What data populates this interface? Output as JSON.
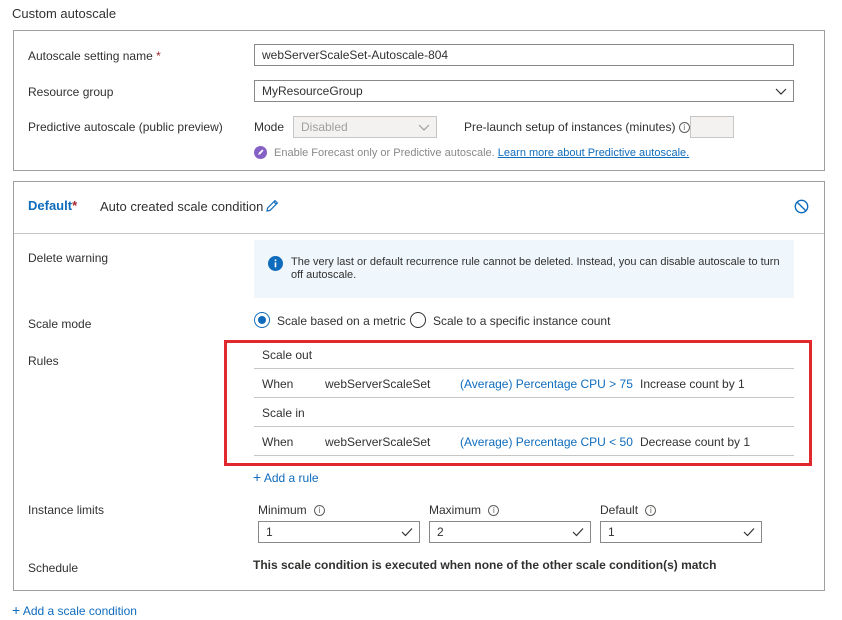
{
  "section": {
    "title": "Custom autoscale"
  },
  "settings": {
    "name_label": "Autoscale setting name",
    "required_mark": "*",
    "name_value": "webServerScaleSet-Autoscale-804",
    "rg_label": "Resource group",
    "rg_value": "MyResourceGroup",
    "predictive_label": "Predictive autoscale (public preview)",
    "mode_label": "Mode",
    "mode_value": "Disabled",
    "prelaunch_label": "Pre-launch setup of instances (minutes)",
    "prelaunch_value": "",
    "forecast_text": "Enable Forecast only or Predictive autoscale.",
    "forecast_link": "Learn more about Predictive autoscale."
  },
  "condition": {
    "title": "Default",
    "required_mark": "*",
    "name": "Auto created scale condition",
    "delete_warning_label": "Delete warning",
    "delete_warning_text": "The very last or default recurrence rule cannot be deleted. Instead, you can disable autoscale to turn off autoscale.",
    "scale_mode_label": "Scale mode",
    "scale_mode_options": [
      "Scale based on a metric",
      "Scale to a specific instance count"
    ],
    "rules_label": "Rules",
    "scale_out_title": "Scale out",
    "scale_in_title": "Scale in",
    "scale_out_rule": {
      "when": "When",
      "resource": "webServerScaleSet",
      "metric": "(Average) Percentage CPU > 75",
      "action": "Increase count by 1"
    },
    "scale_in_rule": {
      "when": "When",
      "resource": "webServerScaleSet",
      "metric": "(Average) Percentage CPU < 50",
      "action": "Decrease count by 1"
    },
    "add_rule": "Add a rule",
    "instance_limits_label": "Instance limits",
    "min_label": "Minimum",
    "min_value": "1",
    "max_label": "Maximum",
    "max_value": "2",
    "default_label": "Default",
    "default_value": "1",
    "schedule_label": "Schedule",
    "schedule_text": "This scale condition is executed when none of the other scale condition(s) match"
  },
  "footer": {
    "add_condition": "Add a scale condition"
  },
  "colors": {
    "accent": "#0f6cbd",
    "highlight": "#e0282e",
    "info_bg": "#eff6fc",
    "rocket": "#8661c5"
  }
}
